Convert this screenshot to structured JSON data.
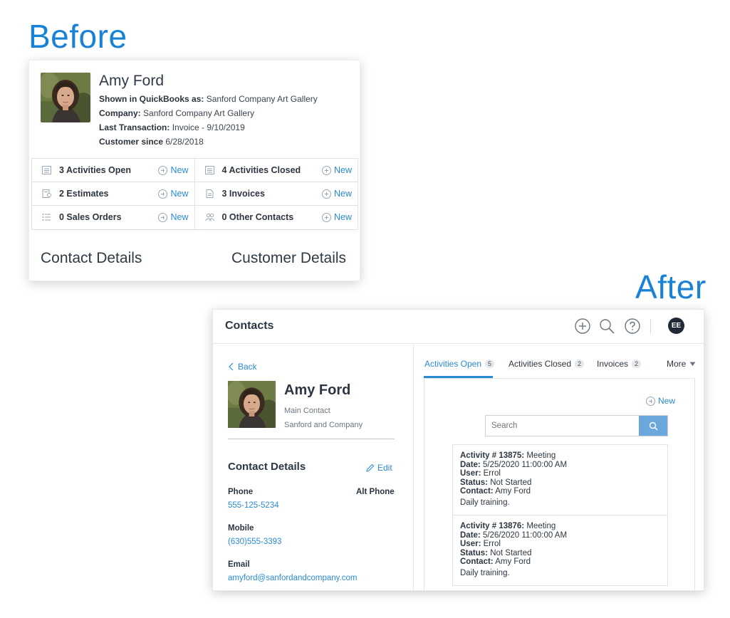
{
  "labels": {
    "before": "Before",
    "after": "After"
  },
  "before": {
    "name": "Amy Ford",
    "info": [
      {
        "key": "Shown in QuickBooks as:",
        "value": "Sanford Company Art Gallery"
      },
      {
        "key": "Company:",
        "value": "Sanford Company Art Gallery"
      },
      {
        "key": "Last Transaction:",
        "value": "Invoice - 9/10/2019"
      },
      {
        "key": "Customer since",
        "value": "6/28/2018"
      }
    ],
    "grid": [
      {
        "label": "3 Activities Open",
        "icon": "list-icon",
        "action": "New"
      },
      {
        "label": "4 Activities Closed",
        "icon": "list-icon",
        "action": "New"
      },
      {
        "label": "2 Estimates",
        "icon": "estimate-icon",
        "action": "New"
      },
      {
        "label": "3 Invoices",
        "icon": "document-icon",
        "action": "New"
      },
      {
        "label": "0 Sales Orders",
        "icon": "bullet-list-icon",
        "action": "New"
      },
      {
        "label": "0 Other Contacts",
        "icon": "people-icon",
        "action": "New"
      }
    ],
    "contact_details": "Contact Details",
    "customer_details": "Customer Details"
  },
  "after": {
    "header": {
      "title": "Contacts",
      "avatar": "EE"
    },
    "back": "Back",
    "name": "Amy Ford",
    "role": "Main Contact",
    "company": "Sanford and Company",
    "contact_details_title": "Contact Details",
    "edit": "Edit",
    "fields": {
      "phone_label": "Phone",
      "phone": "555-125-5234",
      "alt_phone_label": "Alt Phone",
      "mobile_label": "Mobile",
      "mobile": "(630)555-3393",
      "email_label": "Email",
      "email": "amyford@sanfordandcompany.com"
    },
    "tabs": [
      {
        "label": "Activities Open",
        "count": "5"
      },
      {
        "label": "Activities Closed",
        "count": "2"
      },
      {
        "label": "Invoices",
        "count": "2"
      },
      {
        "label": "More"
      }
    ],
    "new_label": "New",
    "search_placeholder": "Search",
    "activities": [
      {
        "title_key": "Activity # 13875:",
        "title_val": "Meeting",
        "date": "5/25/2020 11:00:00 AM",
        "user": "Errol",
        "status": "Not Started",
        "contact": "Amy Ford",
        "note": "Daily training."
      },
      {
        "title_key": "Activity # 13876:",
        "title_val": "Meeting",
        "date": "5/26/2020 11:00:00 AM",
        "user": "Errol",
        "status": "Not Started",
        "contact": "Amy Ford",
        "note": "Daily training."
      }
    ],
    "field_keys": {
      "date": "Date:",
      "user": "User:",
      "status": "Status:",
      "contact": "Contact:"
    }
  },
  "colors": {
    "accent": "#2a8ad4",
    "label_blue": "#1a82d6",
    "avatar_bg": "#1f2a36"
  }
}
